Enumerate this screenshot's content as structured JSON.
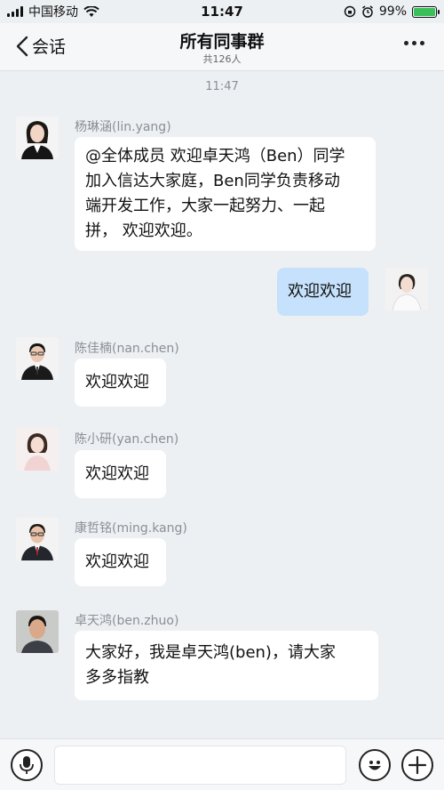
{
  "status_bar": {
    "carrier": "中国移动",
    "time": "11:47",
    "battery": "99%"
  },
  "nav": {
    "back_label": "会话",
    "title": "所有同事群",
    "subtitle": "共126人"
  },
  "chat": {
    "timestamp": "11:47",
    "messages": [
      {
        "sender": "杨琳涵(lin.yang)",
        "lines": [
          "@全体成员 欢迎卓天鸿（Ben）同学",
          "加入信达大家庭，Ben同学负责移动",
          "端开发工作，大家一起努力、一起",
          "拼， 欢迎欢迎。"
        ]
      },
      {
        "sender": "",
        "lines": [
          "欢迎欢迎"
        ],
        "mine": true
      },
      {
        "sender": "陈佳楠(nan.chen)",
        "lines": [
          "欢迎欢迎"
        ]
      },
      {
        "sender": "陈小研(yan.chen)",
        "lines": [
          "欢迎欢迎"
        ]
      },
      {
        "sender": "康哲铭(ming.kang)",
        "lines": [
          "欢迎欢迎"
        ]
      },
      {
        "sender": "卓天鸿(ben.zhuo)",
        "lines": [
          "大家好，我是卓天鸿(ben)，请大家",
          "多多指教"
        ]
      }
    ]
  },
  "input": {
    "value": "",
    "placeholder": ""
  },
  "colors": {
    "background": "#edf0f3",
    "my_bubble": "#c5e1fb",
    "other_bubble": "#ffffff"
  }
}
